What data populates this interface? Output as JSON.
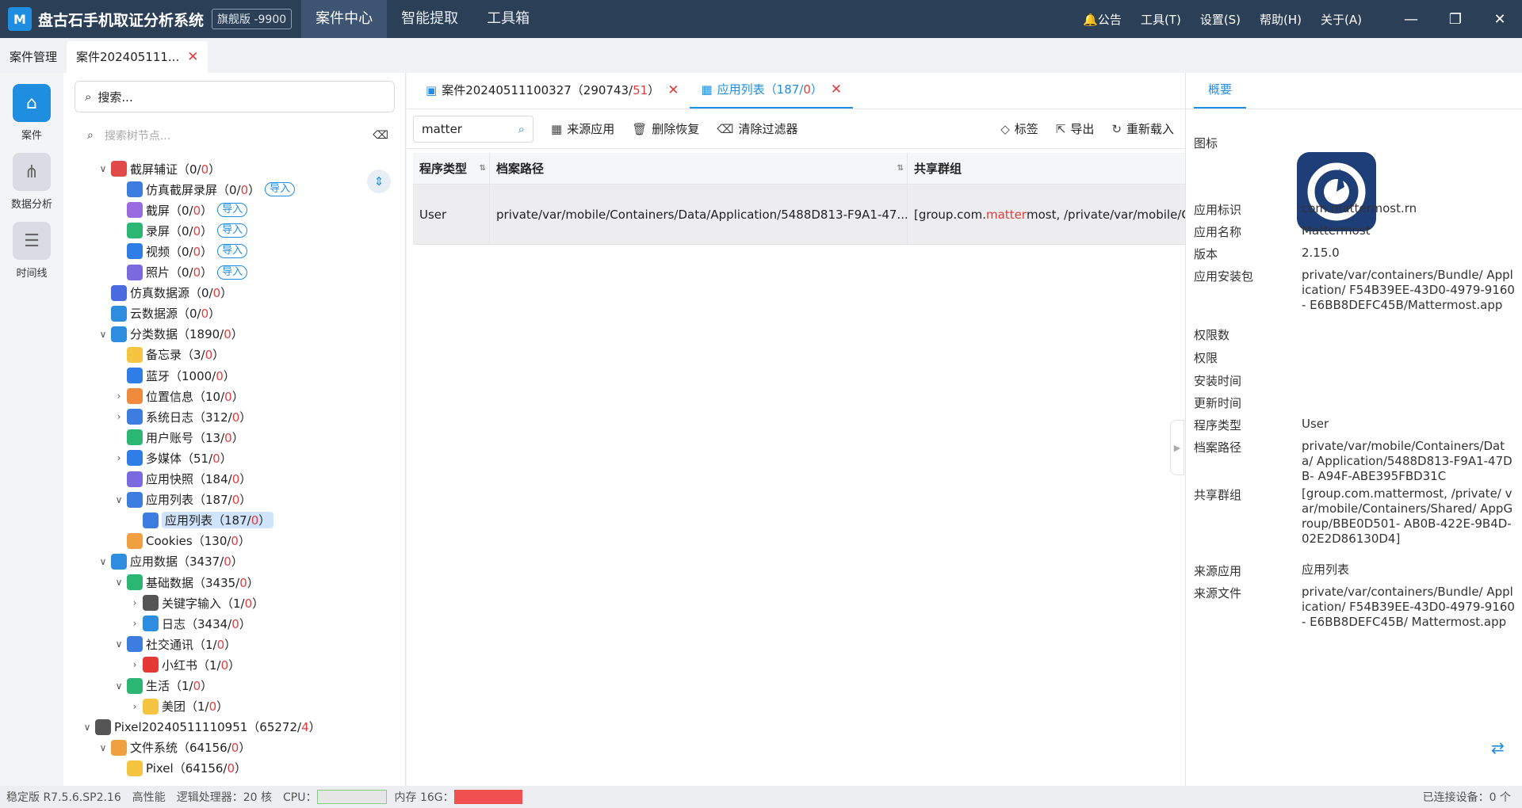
{
  "title": {
    "logo_letter": "M",
    "app_name": "盘古石手机取证分析系统",
    "edition": "旗舰版 -9900"
  },
  "nav_tabs": [
    "案件中心",
    "智能提取",
    "工具箱"
  ],
  "top_menu": {
    "notice": "公告",
    "tools": "工具(T)",
    "settings": "设置(S)",
    "help": "帮助(H)",
    "about": "关于(A)"
  },
  "case_tabs": [
    {
      "label": "案件管理"
    },
    {
      "label": "案件202405111..."
    }
  ],
  "left_nav": [
    {
      "label": "案件"
    },
    {
      "label": "数据分析"
    },
    {
      "label": "时间线"
    }
  ],
  "tree_panel": {
    "search_placeholder": "搜索...",
    "node_search_placeholder": "搜索树节点..."
  },
  "tree": [
    {
      "label": "截屏辅证（0/",
      "red": "0",
      "tail": "）",
      "depth": 1,
      "chev": "v",
      "color": "#e24a4a"
    },
    {
      "label": "仿真截屏录屏（0/",
      "red": "0",
      "tail": "）",
      "depth": 2,
      "chev": "",
      "color": "#3d7de0",
      "import": "导入"
    },
    {
      "label": "截屏（0/",
      "red": "0",
      "tail": "）",
      "depth": 2,
      "chev": "",
      "color": "#9a6ae0",
      "import": "导入"
    },
    {
      "label": "录屏（0/",
      "red": "0",
      "tail": "）",
      "depth": 2,
      "chev": "",
      "color": "#2bb673",
      "import": "导入"
    },
    {
      "label": "视频（0/",
      "red": "0",
      "tail": "）",
      "depth": 2,
      "chev": "",
      "color": "#2f7de6",
      "import": "导入"
    },
    {
      "label": "照片（0/",
      "red": "0",
      "tail": "）",
      "depth": 2,
      "chev": "",
      "color": "#7a6ae0",
      "import": "导入"
    },
    {
      "label": "仿真数据源（0/",
      "red": "0",
      "tail": "）",
      "depth": 1,
      "chev": "",
      "color": "#4a6ae0"
    },
    {
      "label": "云数据源（0/",
      "red": "0",
      "tail": "）",
      "depth": 1,
      "chev": "",
      "color": "#2f8de0"
    },
    {
      "label": "分类数据（1890/",
      "red": "0",
      "tail": "）",
      "depth": 1,
      "chev": "v",
      "color": "#2f8de0"
    },
    {
      "label": "备忘录（3/",
      "red": "0",
      "tail": "）",
      "depth": 2,
      "chev": "",
      "color": "#f5c542"
    },
    {
      "label": "蓝牙（1000/",
      "red": "0",
      "tail": "）",
      "depth": 2,
      "chev": "",
      "color": "#2f7de6"
    },
    {
      "label": "位置信息（10/",
      "red": "0",
      "tail": "）",
      "depth": 2,
      "chev": ">",
      "color": "#f08a3c"
    },
    {
      "label": "系统日志（312/",
      "red": "0",
      "tail": "）",
      "depth": 2,
      "chev": ">",
      "color": "#3d7de0"
    },
    {
      "label": "用户账号（13/",
      "red": "0",
      "tail": "）",
      "depth": 2,
      "chev": "",
      "color": "#2bb673"
    },
    {
      "label": "多媒体（51/",
      "red": "0",
      "tail": "）",
      "depth": 2,
      "chev": ">",
      "color": "#2f7de6"
    },
    {
      "label": "应用快照（184/",
      "red": "0",
      "tail": "）",
      "depth": 2,
      "chev": "",
      "color": "#7a6ae0"
    },
    {
      "label": "应用列表（187/",
      "red": "0",
      "tail": "）",
      "depth": 2,
      "chev": "v",
      "color": "#3d7de0"
    },
    {
      "label": "应用列表（187/",
      "red": "0",
      "tail": "）",
      "depth": 3,
      "chev": "",
      "color": "#3d7de0",
      "selected": true
    },
    {
      "label": "Cookies（130/",
      "red": "0",
      "tail": "）",
      "depth": 2,
      "chev": "",
      "color": "#f0a040"
    },
    {
      "label": "应用数据（3437/",
      "red": "0",
      "tail": "）",
      "depth": 1,
      "chev": "v",
      "color": "#2f8de0"
    },
    {
      "label": "基础数据（3435/",
      "red": "0",
      "tail": "）",
      "depth": 2,
      "chev": "v",
      "color": "#2bb673"
    },
    {
      "label": "关键字输入（1/",
      "red": "0",
      "tail": "）",
      "depth": 3,
      "chev": ">",
      "color": "#555"
    },
    {
      "label": "日志（3434/",
      "red": "0",
      "tail": "）",
      "depth": 3,
      "chev": ">",
      "color": "#2f8de0"
    },
    {
      "label": "社交通讯（1/",
      "red": "0",
      "tail": "）",
      "depth": 2,
      "chev": "v",
      "color": "#3d7de0"
    },
    {
      "label": "小红书（1/",
      "red": "0",
      "tail": "）",
      "depth": 3,
      "chev": ">",
      "color": "#e53935"
    },
    {
      "label": "生活（1/",
      "red": "0",
      "tail": "）",
      "depth": 2,
      "chev": "v",
      "color": "#2bb673"
    },
    {
      "label": "美团（1/",
      "red": "0",
      "tail": "）",
      "depth": 3,
      "chev": ">",
      "color": "#f5c542"
    },
    {
      "label": "Pixel20240511110951（65272/",
      "red": "4",
      "tail": "）",
      "depth": 0,
      "chev": "v",
      "color": "#555"
    },
    {
      "label": "文件系统（64156/",
      "red": "0",
      "tail": "）",
      "depth": 1,
      "chev": "v",
      "color": "#f0a040"
    },
    {
      "label": "Pixel（64156/",
      "red": "0",
      "tail": "）",
      "depth": 2,
      "chev": "",
      "color": "#f5c542"
    }
  ],
  "main_tabs": [
    {
      "label": "案件20240511100327（290743/",
      "red": "51",
      "tail": "）"
    },
    {
      "label": "应用列表（187/",
      "red": "0",
      "tail": "）"
    }
  ],
  "toolbar": {
    "filter_value": "matter",
    "source_app": "来源应用",
    "delete_restore": "删除恢复",
    "clear_filter": "清除过滤器",
    "tag": "标签",
    "export": "导出",
    "reload": "重新载入"
  },
  "table": {
    "headers": [
      "程序类型",
      "档案路径",
      "共享群组"
    ],
    "rows": [
      {
        "type": "User",
        "path": "private/var/mobile/Containers/Data/Application/5488D813-F9A1-47...",
        "group_pre": "[group.com.",
        "group_hl": "matter",
        "group_post": "most, /private/var/mobile/Co"
      }
    ]
  },
  "detail": {
    "tab": "概要",
    "fields": [
      {
        "label": "图标",
        "value": ""
      },
      {
        "label": "应用标识",
        "value": "com.mattermost.rn"
      },
      {
        "label": "应用名称",
        "value": "Mattermost"
      },
      {
        "label": "版本",
        "value": "2.15.0"
      },
      {
        "label": "应用安装包",
        "value": "private/var/containers/Bundle/ Application/ F54B39EE-43D0-4979-9160- E6BB8DEFC45B/Mattermost.app"
      },
      {
        "label": "权限数",
        "value": ""
      },
      {
        "label": "权限",
        "value": ""
      },
      {
        "label": "安装时间",
        "value": ""
      },
      {
        "label": "更新时间",
        "value": ""
      },
      {
        "label": "程序类型",
        "value": "User"
      },
      {
        "label": "档案路径",
        "value": "private/var/mobile/Containers/Data/ Application/5488D813-F9A1-47DB- A94F-ABE395FBD31C"
      },
      {
        "label": "共享群组",
        "value": "[group.com.mattermost, /private/ var/mobile/Containers/Shared/ AppGroup/BBE0D501- AB0B-422E-9B4D-02E2D86130D4]"
      },
      {
        "label": "来源应用",
        "value": "应用列表"
      },
      {
        "label": "来源文件",
        "value": "private/var/containers/Bundle/ Application/ F54B39EE-43D0-4979-9160- E6BB8DEFC45B/ Mattermost.app"
      }
    ]
  },
  "status": {
    "version": "稳定版 R7.5.6.SP2.16",
    "perf": "高性能",
    "cpu_cores": "逻辑处理器：20 核",
    "cpu_label": "CPU：",
    "mem_label": "内存 16G：",
    "connected": "已连接设备：0 个"
  }
}
